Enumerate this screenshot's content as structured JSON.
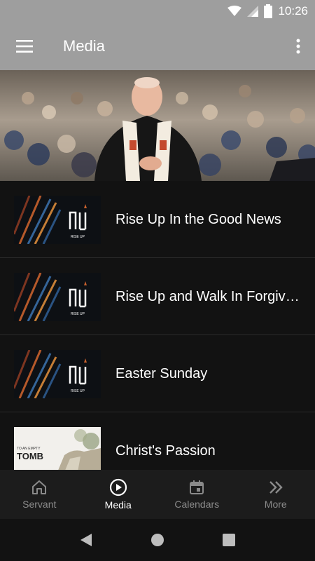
{
  "status_bar": {
    "time": "10:26"
  },
  "app_bar": {
    "title": "Media"
  },
  "media_list": [
    {
      "title": "Rise Up In the Good News",
      "thumb_text": "RISE UP"
    },
    {
      "title": "Rise Up and Walk In Forgiveness",
      "thumb_text": "RISE UP"
    },
    {
      "title": "Easter Sunday",
      "thumb_text": "RISE UP"
    },
    {
      "title": "Christ's Passion",
      "thumb_text_top": "TO AN EMPTY",
      "thumb_text_main": "TOMB"
    }
  ],
  "bottom_nav": {
    "items": [
      {
        "label": "Servant",
        "icon": "home-icon"
      },
      {
        "label": "Media",
        "icon": "play-circle-icon"
      },
      {
        "label": "Calendars",
        "icon": "calendar-icon"
      },
      {
        "label": "More",
        "icon": "chevron-double-right-icon"
      }
    ],
    "active": "Media"
  },
  "colors": {
    "app_bar": "#9e9e9e",
    "background": "#121212",
    "nav_bg": "#1c1c1c",
    "inactive": "#8a8a8a"
  }
}
